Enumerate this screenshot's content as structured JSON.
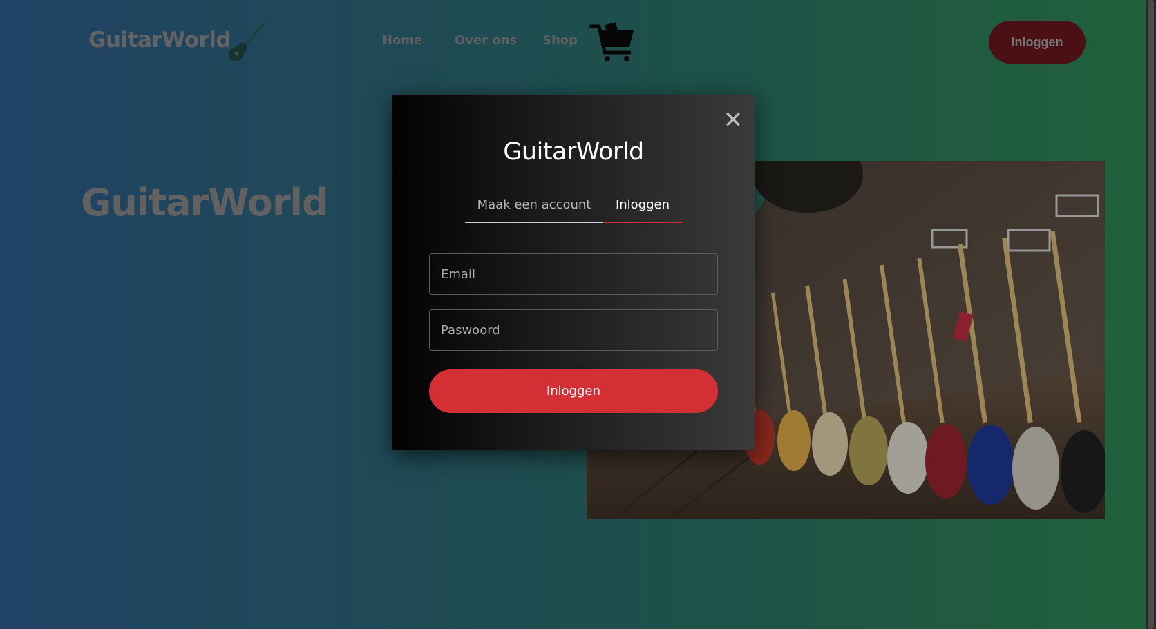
{
  "header": {
    "logo": "GuitarWorld",
    "nav": [
      {
        "label": "Home"
      },
      {
        "label": "Over ons"
      },
      {
        "label": "Shop"
      }
    ],
    "login_button": "Inloggen"
  },
  "hero": {
    "title": "GuitarWorld"
  },
  "modal": {
    "title": "GuitarWorld",
    "tabs": [
      {
        "label": "Maak een account",
        "active": false
      },
      {
        "label": "Inloggen",
        "active": true
      }
    ],
    "email_placeholder": "Email",
    "password_placeholder": "Paswoord",
    "submit_label": "Inloggen"
  },
  "colors": {
    "accent": "#d32f34",
    "header_button": "#6a1820"
  }
}
